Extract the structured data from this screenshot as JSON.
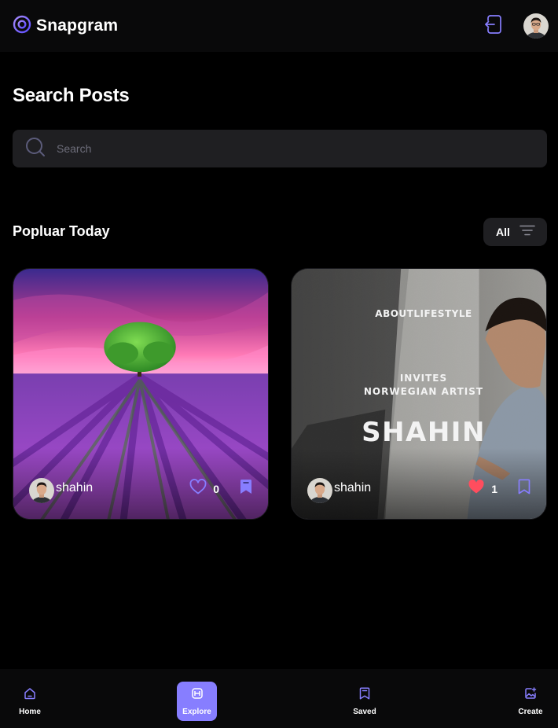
{
  "app": {
    "name": "Snapgram"
  },
  "colors": {
    "accent": "#877eff",
    "background": "#000000",
    "surface": "#1f1f22",
    "like": "#ff5a5a"
  },
  "header": {
    "logout_icon": "logout-icon",
    "user_avatar": "profile-avatar"
  },
  "page": {
    "title": "Search Posts"
  },
  "search": {
    "placeholder": "Search",
    "value": "",
    "icon": "search-icon"
  },
  "popular": {
    "title": "Popluar Today",
    "filter_label": "All",
    "filter_icon": "filter-icon"
  },
  "posts": [
    {
      "creator": "shahin",
      "likes": "0",
      "liked": false,
      "saved": true,
      "image": "lavender-field-tree"
    },
    {
      "creator": "shahin",
      "likes": "1",
      "liked": true,
      "saved": false,
      "image": "event-poster",
      "poster": {
        "brand": "ABOUTLIFESTYLE",
        "line1": "INVITES",
        "line2": "NORWEGIAN ARTIST",
        "headline": "SHAHIN"
      }
    }
  ],
  "bottom_nav": [
    {
      "label": "Home",
      "icon": "home-icon",
      "active": false
    },
    {
      "label": "Explore",
      "icon": "explore-icon",
      "active": true
    },
    {
      "label": "Saved",
      "icon": "bookmark-icon",
      "active": false
    },
    {
      "label": "Create",
      "icon": "add-image-icon",
      "active": false
    }
  ]
}
